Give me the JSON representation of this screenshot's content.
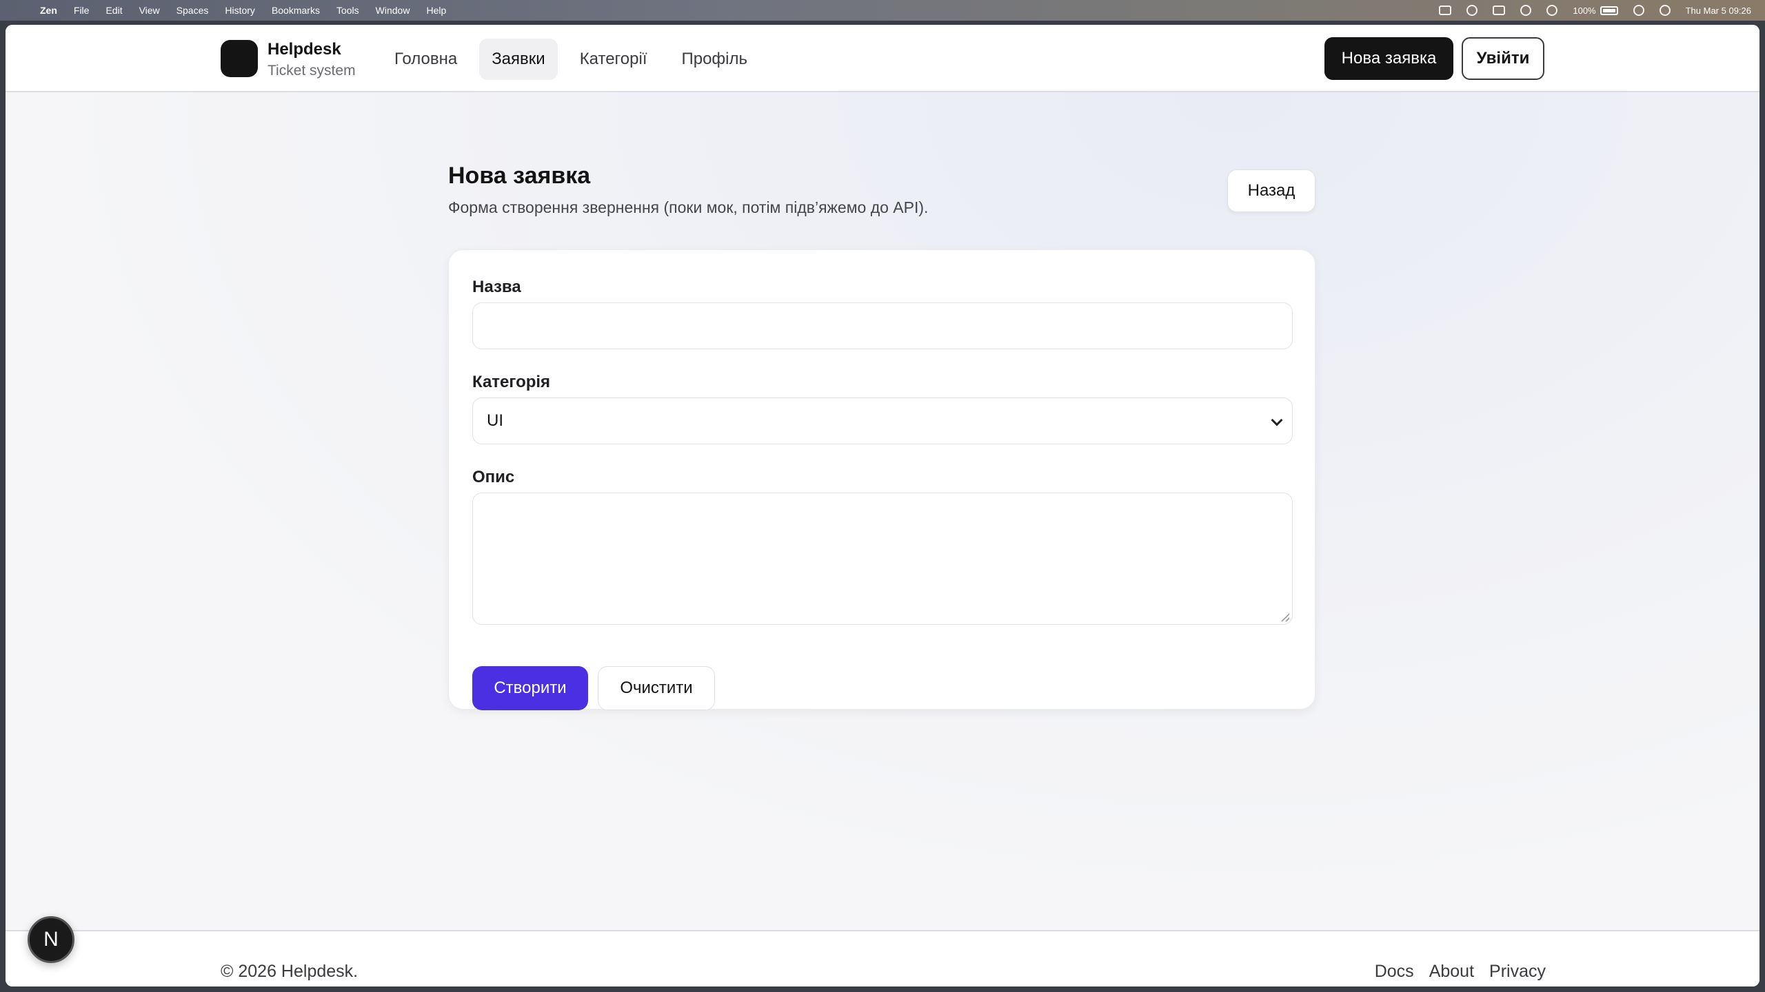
{
  "menubar": {
    "app": "Zen",
    "menus": [
      "File",
      "Edit",
      "View",
      "Spaces",
      "History",
      "Bookmarks",
      "Tools",
      "Window",
      "Help"
    ],
    "battery": "100%",
    "datetime": "Thu Mar 5  09:26"
  },
  "header": {
    "brand_title": "Helpdesk",
    "brand_subtitle": "Ticket system",
    "nav": [
      {
        "label": "Головна",
        "active": false
      },
      {
        "label": "Заявки",
        "active": true
      },
      {
        "label": "Категорії",
        "active": false
      },
      {
        "label": "Профіль",
        "active": false
      }
    ],
    "new_ticket_label": "Нова заявка",
    "login_label": "Увійти"
  },
  "main": {
    "title": "Нова заявка",
    "description": "Форма створення звернення (поки мок, потім підв’яжемо до API).",
    "back_label": "Назад",
    "form": {
      "name_label": "Назва",
      "name_value": "",
      "category_label": "Категорія",
      "category_value": "UI",
      "description_label": "Опис",
      "description_value": "",
      "create_label": "Створити",
      "clear_label": "Очистити"
    }
  },
  "footer": {
    "copyright": "© 2026 Helpdesk.",
    "links": [
      "Docs",
      "About",
      "Privacy"
    ]
  },
  "dev_badge": "N",
  "colors": {
    "primary": "#4a2fe3",
    "dark": "#141414"
  }
}
